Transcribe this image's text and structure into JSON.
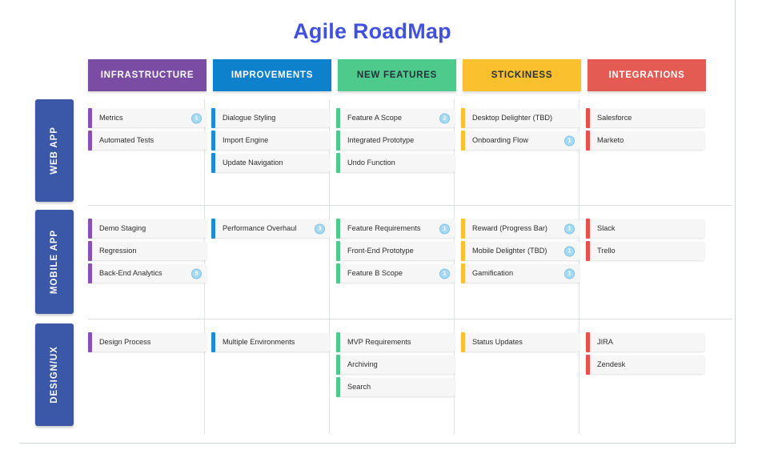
{
  "title": "Agile RoadMap",
  "colors": {
    "title_accent": "#4a4ad4",
    "row_label_bg": "#3a57a8",
    "badge_bg": "#a6d9f2",
    "badge_border": "#7ec2e8",
    "card_bg": "#f6f6f6",
    "divider": "#dfe3e6",
    "frame": "#c8d4d6"
  },
  "columns": [
    {
      "label": "INFRASTRUCTURE",
      "bg": "#7a4ca3",
      "fg": "#ffffff",
      "bar": "#8e4fb0"
    },
    {
      "label": "IMPROVEMENTS",
      "bg": "#0d81cc",
      "fg": "#ffffff",
      "bar": "#1e8bd6"
    },
    {
      "label": "NEW FEATURES",
      "bg": "#4ecb8c",
      "fg": "#24313a",
      "bar": "#4ecb8c"
    },
    {
      "label": "STICKINESS",
      "bg": "#fbc02d",
      "fg": "#24313a",
      "bar": "#fbc02d"
    },
    {
      "label": "INTEGRATIONS",
      "bg": "#e35b52",
      "fg": "#ffffff",
      "bar": "#e8504a"
    }
  ],
  "rows": [
    {
      "label": "WEB APP",
      "cells": [
        [
          {
            "label": "Metrics",
            "badge": "1"
          },
          {
            "label": "Automated Tests",
            "badge": ""
          }
        ],
        [
          {
            "label": "Dialogue Styling",
            "badge": ""
          },
          {
            "label": "Import Engine",
            "badge": ""
          },
          {
            "label": "Update Navigation",
            "badge": ""
          }
        ],
        [
          {
            "label": "Feature A Scope",
            "badge": "2"
          },
          {
            "label": "Integrated Prototype",
            "badge": ""
          },
          {
            "label": "Undo Function",
            "badge": ""
          }
        ],
        [
          {
            "label": "Desktop Delighter (TBD)",
            "badge": ""
          },
          {
            "label": "Onboarding Flow",
            "badge": "1"
          }
        ],
        [
          {
            "label": "Salesforce",
            "badge": ""
          },
          {
            "label": "Marketo",
            "badge": ""
          }
        ]
      ]
    },
    {
      "label": "MOBILE APP",
      "cells": [
        [
          {
            "label": "Demo Staging",
            "badge": ""
          },
          {
            "label": "Regression",
            "badge": ""
          },
          {
            "label": "Back-End Analytics",
            "badge": "5"
          }
        ],
        [
          {
            "label": "Performance Overhaul",
            "badge": "3"
          }
        ],
        [
          {
            "label": "Feature Requirements",
            "badge": "1"
          },
          {
            "label": "Front-End Prototype",
            "badge": ""
          },
          {
            "label": "Feature B Scope",
            "badge": "1"
          }
        ],
        [
          {
            "label": "Reward (Progress Bar)",
            "badge": "1"
          },
          {
            "label": "Mobile Delighter (TBD)",
            "badge": "1"
          },
          {
            "label": "Gamification",
            "badge": "1"
          }
        ],
        [
          {
            "label": "Slack",
            "badge": ""
          },
          {
            "label": "Trello",
            "badge": ""
          }
        ]
      ]
    },
    {
      "label": "DESIGN/UX",
      "cells": [
        [
          {
            "label": "Design Process",
            "badge": ""
          }
        ],
        [
          {
            "label": "Multiple Environments",
            "badge": ""
          }
        ],
        [
          {
            "label": "MVP Requirements",
            "badge": ""
          },
          {
            "label": "Archiving",
            "badge": ""
          },
          {
            "label": "Search",
            "badge": ""
          }
        ],
        [
          {
            "label": "Status Updates",
            "badge": ""
          }
        ],
        [
          {
            "label": "JIRA",
            "badge": ""
          },
          {
            "label": "Zendesk",
            "badge": ""
          }
        ]
      ]
    }
  ],
  "layout": {
    "row_tops": [
      0,
      138,
      280
    ],
    "row_label_heights": [
      128,
      130,
      128
    ],
    "row_cell_tops": [
      12,
      150,
      292
    ],
    "divider_tops": [
      132,
      274
    ],
    "col_lefts": [
      66,
      220,
      376,
      532,
      688
    ],
    "col_divider_lefts": [
      211,
      367,
      523,
      679
    ],
    "header_lefts": [
      0,
      156,
      312,
      468,
      624
    ]
  }
}
